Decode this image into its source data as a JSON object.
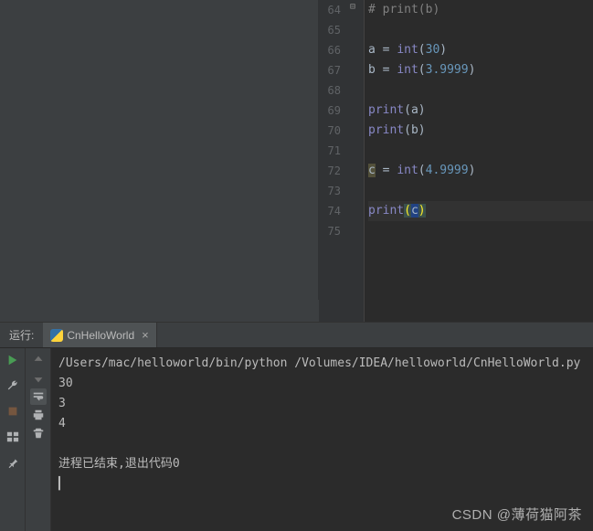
{
  "editor": {
    "startLine": 64,
    "endLine": 75,
    "foldMarker": "⊟",
    "lines": {
      "64": {
        "type": "comment",
        "text": "# print(b)"
      },
      "65": {
        "type": "blank"
      },
      "66": {
        "type": "assign_int",
        "var": "a",
        "arg": "30"
      },
      "67": {
        "type": "assign_int",
        "var": "b",
        "arg": "3.9999"
      },
      "68": {
        "type": "blank"
      },
      "69": {
        "type": "print",
        "arg": "a"
      },
      "70": {
        "type": "print",
        "arg": "b"
      },
      "71": {
        "type": "blank"
      },
      "72": {
        "type": "assign_int",
        "var": "c",
        "arg": "4.9999",
        "warnVar": true
      },
      "73": {
        "type": "blank"
      },
      "74": {
        "type": "print_caret",
        "arg": "c"
      },
      "75": {
        "type": "blank"
      }
    }
  },
  "run": {
    "label": "运行:",
    "tabName": "CnHelloWorld",
    "closeGlyph": "×",
    "output": {
      "cmd": "/Users/mac/helloworld/bin/python /Volumes/IDEA/helloworld/CnHelloWorld.py",
      "lines": [
        "30",
        "3",
        "4"
      ],
      "exitMsg": "进程已结束,退出代码0",
      "cursor": "▎"
    }
  },
  "icons": {
    "leftCol": [
      "play",
      "wrench",
      "stop",
      "layout",
      "pin"
    ],
    "rightCol": [
      "up",
      "down",
      "wrap",
      "print",
      "trash"
    ]
  },
  "watermark": "CSDN @薄荷猫阿茶"
}
